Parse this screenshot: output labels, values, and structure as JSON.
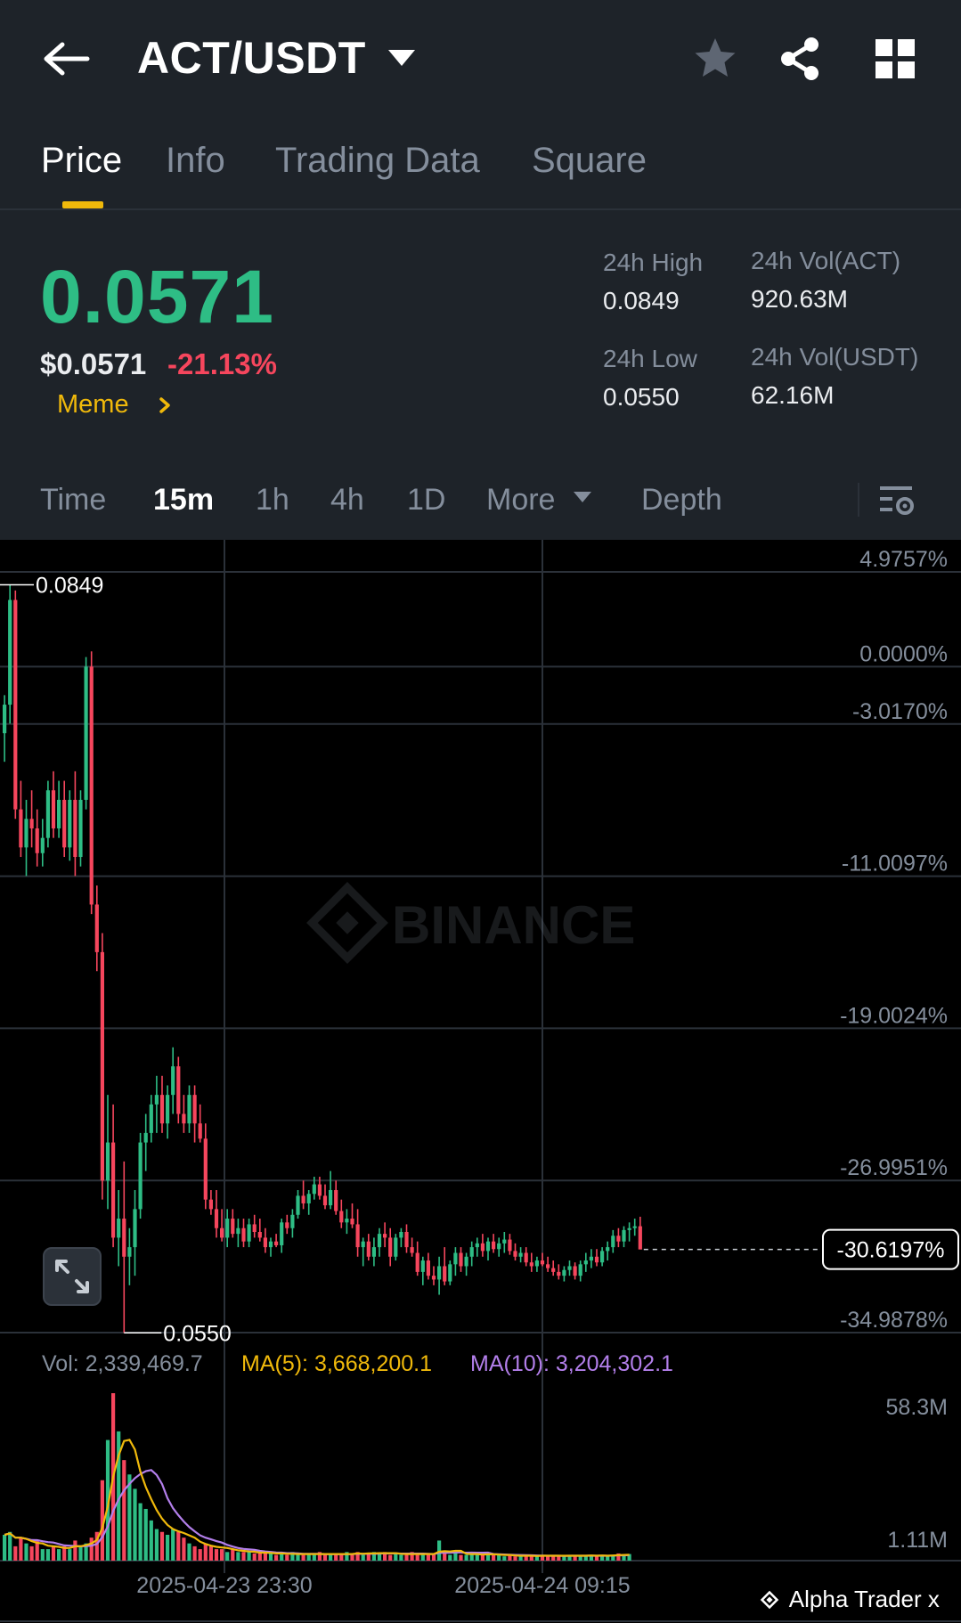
{
  "header": {
    "pair": "ACT/USDT",
    "icons": [
      "back-arrow-icon",
      "dropdown-caret-icon",
      "star-icon",
      "share-icon",
      "grid-icon"
    ]
  },
  "tabs": [
    {
      "label": "Price",
      "active": true
    },
    {
      "label": "Info",
      "active": false
    },
    {
      "label": "Trading Data",
      "active": false
    },
    {
      "label": "Square",
      "active": false
    }
  ],
  "ticker": {
    "last_price": "0.0571",
    "usd_price": "$0.0571",
    "change_pct": "-21.13%",
    "tag": "Meme",
    "high_label": "24h High",
    "high": "0.0849",
    "low_label": "24h Low",
    "low": "0.0550",
    "vol_base_label": "24h Vol(ACT)",
    "vol_base": "920.63M",
    "vol_quote_label": "24h Vol(USDT)",
    "vol_quote": "62.16M"
  },
  "intervals": {
    "items": [
      {
        "label": "Time",
        "active": false
      },
      {
        "label": "15m",
        "active": true
      },
      {
        "label": "1h",
        "active": false
      },
      {
        "label": "4h",
        "active": false
      },
      {
        "label": "1D",
        "active": false
      },
      {
        "label": "More",
        "active": false
      },
      {
        "label": "Depth",
        "active": false
      }
    ]
  },
  "chart": {
    "watermark": "BINANCE",
    "high_marker": "0.0849",
    "low_marker": "0.0550",
    "current_pct": "-30.6197%",
    "vol_summary": "Vol: 2,339,469.7",
    "ma5_summary": "MA(5): 3,668,200.1",
    "ma10_summary": "MA(10): 3,204,302.1",
    "vol_axis_top": "58.3M",
    "vol_axis_bottom": "1.11M",
    "time_labels": [
      "2025-04-23 23:30",
      "2025-04-24 09:15"
    ],
    "footer": "Alpha Trader x"
  },
  "colors": {
    "up": "#2ebd85",
    "down": "#f6465d",
    "accent": "#f0b90b",
    "ma5": "#f0b90b",
    "ma10": "#b37feb"
  },
  "chart_data": {
    "type": "candlestick",
    "interval": "15m",
    "y_axis": "percent change",
    "y_ticks": [
      "4.9757%",
      "0.0000%",
      "-3.0170%",
      "-11.0097%",
      "-19.0024%",
      "-26.9951%",
      "-34.9878%"
    ],
    "y_tick_values": [
      4.9757,
      0.0,
      -3.017,
      -11.0097,
      -19.0024,
      -26.9951,
      -34.9878
    ],
    "ylim_pct": [
      4.9757,
      -34.9878
    ],
    "price_high": 0.0849,
    "price_low": 0.055,
    "current_value_pct": -30.6197,
    "x_ticks": [
      "2025-04-23 23:30",
      "2025-04-24 09:15"
    ],
    "candles_pct": [
      [
        -3.5,
        -1.5,
        -5.0,
        -2.0
      ],
      [
        -2.0,
        4.3,
        -3.0,
        3.5
      ],
      [
        3.5,
        4.0,
        -8.0,
        -7.5
      ],
      [
        -7.5,
        -6.0,
        -10.0,
        -9.5
      ],
      [
        -9.5,
        -7.0,
        -11.0,
        -8.0
      ],
      [
        -8.0,
        -6.5,
        -9.5,
        -8.5
      ],
      [
        -8.5,
        -7.5,
        -10.5,
        -9.8
      ],
      [
        -9.8,
        -8.0,
        -10.5,
        -9.0
      ],
      [
        -9.0,
        -6.0,
        -9.5,
        -6.5
      ],
      [
        -6.5,
        -5.5,
        -9.0,
        -8.5
      ],
      [
        -8.5,
        -6.0,
        -9.0,
        -7.0
      ],
      [
        -7.0,
        -6.0,
        -10.0,
        -9.5
      ],
      [
        -9.5,
        -6.5,
        -10.2,
        -7.0
      ],
      [
        -7.0,
        -5.5,
        -11.0,
        -10.0
      ],
      [
        -10.0,
        -6.5,
        -10.5,
        -7.0
      ],
      [
        -7.0,
        0.5,
        -7.5,
        0.0
      ],
      [
        0.0,
        0.8,
        -13.0,
        -12.5
      ],
      [
        -12.5,
        -11.5,
        -16.0,
        -15.0
      ],
      [
        -15.0,
        -14.0,
        -28.0,
        -27.0
      ],
      [
        -27.0,
        -22.5,
        -28.5,
        -25.0
      ],
      [
        -25.0,
        -23.0,
        -30.5,
        -30.0
      ],
      [
        -30.0,
        -27.5,
        -31.5,
        -29.0
      ],
      [
        -29.0,
        -26.0,
        -35.0,
        -31.0
      ],
      [
        -31.0,
        -29.5,
        -32.5,
        -30.5
      ],
      [
        -30.5,
        -27.5,
        -32.0,
        -28.5
      ],
      [
        -28.5,
        -24.5,
        -29.0,
        -25.0
      ],
      [
        -25.0,
        -23.5,
        -26.5,
        -24.5
      ],
      [
        -24.5,
        -22.5,
        -25.0,
        -23.0
      ],
      [
        -23.0,
        -21.5,
        -24.5,
        -22.5
      ],
      [
        -22.5,
        -21.5,
        -24.5,
        -24.0
      ],
      [
        -24.0,
        -22.0,
        -24.8,
        -22.5
      ],
      [
        -22.5,
        -20.0,
        -23.5,
        -21.0
      ],
      [
        -21.0,
        -20.5,
        -24.0,
        -23.5
      ],
      [
        -23.5,
        -22.5,
        -24.5,
        -24.0
      ],
      [
        -24.0,
        -22.0,
        -24.5,
        -22.5
      ],
      [
        -22.5,
        -22.0,
        -25.0,
        -24.0
      ],
      [
        -24.0,
        -23.0,
        -25.0,
        -24.8
      ],
      [
        -24.8,
        -24.0,
        -28.5,
        -28.0
      ],
      [
        -28.0,
        -27.5,
        -28.8,
        -28.5
      ],
      [
        -28.5,
        -27.5,
        -30.0,
        -29.5
      ],
      [
        -29.5,
        -28.5,
        -30.2,
        -30.0
      ],
      [
        -30.0,
        -28.5,
        -30.5,
        -29.0
      ],
      [
        -29.0,
        -28.5,
        -30.0,
        -29.8
      ],
      [
        -29.8,
        -29.0,
        -30.5,
        -29.5
      ],
      [
        -29.5,
        -29.0,
        -30.5,
        -30.2
      ],
      [
        -30.2,
        -29.0,
        -30.5,
        -29.3
      ],
      [
        -29.3,
        -28.8,
        -30.0,
        -29.7
      ],
      [
        -29.7,
        -29.0,
        -30.2,
        -30.0
      ],
      [
        -30.0,
        -29.5,
        -30.8,
        -30.5
      ],
      [
        -30.5,
        -30.0,
        -31.0,
        -30.2
      ],
      [
        -30.2,
        -29.8,
        -30.5,
        -30.4
      ],
      [
        -30.4,
        -29.0,
        -30.8,
        -29.2
      ],
      [
        -29.2,
        -28.8,
        -29.8,
        -29.5
      ],
      [
        -29.5,
        -28.5,
        -30.0,
        -28.8
      ],
      [
        -28.8,
        -27.5,
        -29.0,
        -27.8
      ],
      [
        -27.8,
        -27.0,
        -28.5,
        -28.2
      ],
      [
        -28.2,
        -27.5,
        -28.8,
        -27.7
      ],
      [
        -27.7,
        -26.8,
        -28.0,
        -27.2
      ],
      [
        -27.2,
        -26.8,
        -28.0,
        -27.8
      ],
      [
        -27.8,
        -27.2,
        -28.5,
        -28.3
      ],
      [
        -28.3,
        -26.5,
        -28.5,
        -27.5
      ],
      [
        -27.5,
        -27.0,
        -28.8,
        -28.6
      ],
      [
        -28.6,
        -28.0,
        -29.5,
        -29.2
      ],
      [
        -29.2,
        -28.5,
        -29.8,
        -29.0
      ],
      [
        -29.0,
        -28.2,
        -29.5,
        -29.3
      ],
      [
        -29.3,
        -28.5,
        -31.0,
        -30.5
      ],
      [
        -30.5,
        -30.0,
        -31.5,
        -30.2
      ],
      [
        -30.2,
        -29.8,
        -31.2,
        -31.0
      ],
      [
        -31.0,
        -30.0,
        -31.5,
        -30.5
      ],
      [
        -30.5,
        -29.5,
        -31.0,
        -29.8
      ],
      [
        -29.8,
        -29.2,
        -30.5,
        -30.0
      ],
      [
        -30.0,
        -29.5,
        -31.5,
        -31.0
      ],
      [
        -31.0,
        -29.8,
        -31.2,
        -30.0
      ],
      [
        -30.0,
        -29.5,
        -30.5,
        -29.7
      ],
      [
        -29.7,
        -29.3,
        -30.8,
        -30.5
      ],
      [
        -30.5,
        -30.0,
        -31.0,
        -30.8
      ],
      [
        -30.8,
        -30.2,
        -32.0,
        -31.8
      ],
      [
        -31.8,
        -31.0,
        -32.5,
        -31.2
      ],
      [
        -31.2,
        -30.8,
        -32.2,
        -32.0
      ],
      [
        -32.0,
        -31.5,
        -32.5,
        -32.2
      ],
      [
        -32.2,
        -31.0,
        -33.0,
        -31.5
      ],
      [
        -31.5,
        -30.5,
        -32.5,
        -32.3
      ],
      [
        -32.3,
        -31.2,
        -32.5,
        -31.4
      ],
      [
        -31.4,
        -30.5,
        -32.0,
        -30.8
      ],
      [
        -30.8,
        -30.5,
        -31.8,
        -31.5
      ],
      [
        -31.5,
        -30.8,
        -32.0,
        -31.0
      ],
      [
        -31.0,
        -30.2,
        -31.5,
        -30.5
      ],
      [
        -30.5,
        -30.0,
        -31.0,
        -30.3
      ],
      [
        -30.3,
        -29.8,
        -31.0,
        -30.7
      ],
      [
        -30.7,
        -30.0,
        -31.2,
        -30.2
      ],
      [
        -30.2,
        -29.8,
        -30.8,
        -30.6
      ],
      [
        -30.6,
        -30.0,
        -31.0,
        -30.3
      ],
      [
        -30.3,
        -29.7,
        -30.8,
        -30.1
      ],
      [
        -30.1,
        -29.8,
        -30.9,
        -30.7
      ],
      [
        -30.7,
        -30.3,
        -31.2,
        -31.0
      ],
      [
        -31.0,
        -30.5,
        -31.3,
        -30.8
      ],
      [
        -30.8,
        -30.5,
        -31.5,
        -31.3
      ],
      [
        -31.3,
        -30.8,
        -31.8,
        -31.5
      ],
      [
        -31.5,
        -31.0,
        -31.8,
        -31.2
      ],
      [
        -31.2,
        -30.8,
        -31.5,
        -31.4
      ],
      [
        -31.4,
        -31.0,
        -31.8,
        -31.6
      ],
      [
        -31.6,
        -31.2,
        -32.0,
        -31.8
      ],
      [
        -31.8,
        -31.4,
        -32.2,
        -32.0
      ],
      [
        -32.0,
        -31.5,
        -32.3,
        -31.7
      ],
      [
        -31.7,
        -31.2,
        -32.0,
        -31.5
      ],
      [
        -31.5,
        -31.3,
        -32.2,
        -32.0
      ],
      [
        -32.0,
        -31.2,
        -32.3,
        -31.4
      ],
      [
        -31.4,
        -30.8,
        -31.8,
        -31.2
      ],
      [
        -31.2,
        -30.6,
        -31.6,
        -31.0
      ],
      [
        -31.0,
        -30.6,
        -31.5,
        -31.3
      ],
      [
        -31.3,
        -30.5,
        -31.5,
        -30.7
      ],
      [
        -30.7,
        -30.2,
        -31.2,
        -30.5
      ],
      [
        -30.5,
        -29.6,
        -30.8,
        -29.9
      ],
      [
        -29.9,
        -29.5,
        -30.5,
        -30.2
      ],
      [
        -30.2,
        -29.4,
        -30.5,
        -29.6
      ],
      [
        -29.6,
        -29.2,
        -30.2,
        -29.5
      ],
      [
        -29.5,
        -29.0,
        -29.9,
        -29.4
      ],
      [
        -29.4,
        -28.9,
        -30.0,
        -30.6197
      ]
    ],
    "volumes_m": [
      9,
      10,
      5,
      8,
      6,
      5,
      7,
      4,
      4,
      5,
      4,
      5,
      4,
      7,
      5,
      6,
      8,
      10,
      28,
      42,
      58.3,
      45,
      35,
      30,
      25,
      20,
      18,
      14,
      11,
      10,
      9,
      11,
      10,
      8,
      6,
      5,
      4,
      6,
      5,
      4,
      4,
      3,
      4,
      3,
      3,
      3,
      2.5,
      2.5,
      3,
      2.5,
      2,
      2.5,
      2,
      3,
      2,
      2,
      2.5,
      2,
      3,
      2,
      2,
      2.5,
      2,
      3,
      2,
      3,
      2,
      2.5,
      3,
      2.5,
      3,
      2,
      2.5,
      2,
      2,
      3,
      2,
      2.5,
      2,
      2,
      7,
      3,
      2,
      3,
      2,
      2,
      2.5,
      2,
      2,
      2.5,
      2,
      2,
      1.5,
      2,
      1.5,
      1.5,
      2,
      1.5,
      1.5,
      2,
      1.5,
      2,
      1.5,
      1.5,
      2,
      1.5,
      2,
      1.5,
      2,
      1.5,
      2,
      1.5,
      2,
      2.5,
      2,
      2.3
    ],
    "volume_ylim_m": [
      0,
      58.3
    ],
    "ma_series": [
      {
        "name": "MA(5)",
        "color": "#f0b90b"
      },
      {
        "name": "MA(10)",
        "color": "#b37feb"
      }
    ]
  }
}
